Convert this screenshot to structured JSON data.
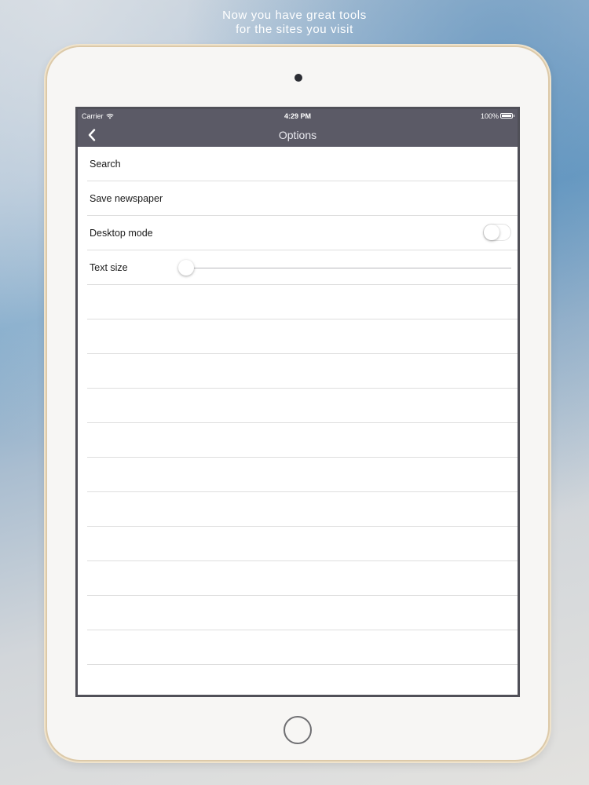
{
  "tagline": {
    "line1": "Now you have great tools",
    "line2": "for the sites you visit"
  },
  "status_bar": {
    "carrier": "Carrier",
    "time": "4:29 PM",
    "battery": "100%"
  },
  "nav_bar": {
    "title": "Options",
    "back_icon": "chevron-left-icon"
  },
  "options": {
    "search_label": "Search",
    "save_newspaper_label": "Save newspaper",
    "desktop_mode_label": "Desktop mode",
    "desktop_mode_on": false,
    "text_size_label": "Text size",
    "text_size_value": 0.0
  },
  "colors": {
    "nav_background": "#5b5a66",
    "separator": "#dedede"
  }
}
